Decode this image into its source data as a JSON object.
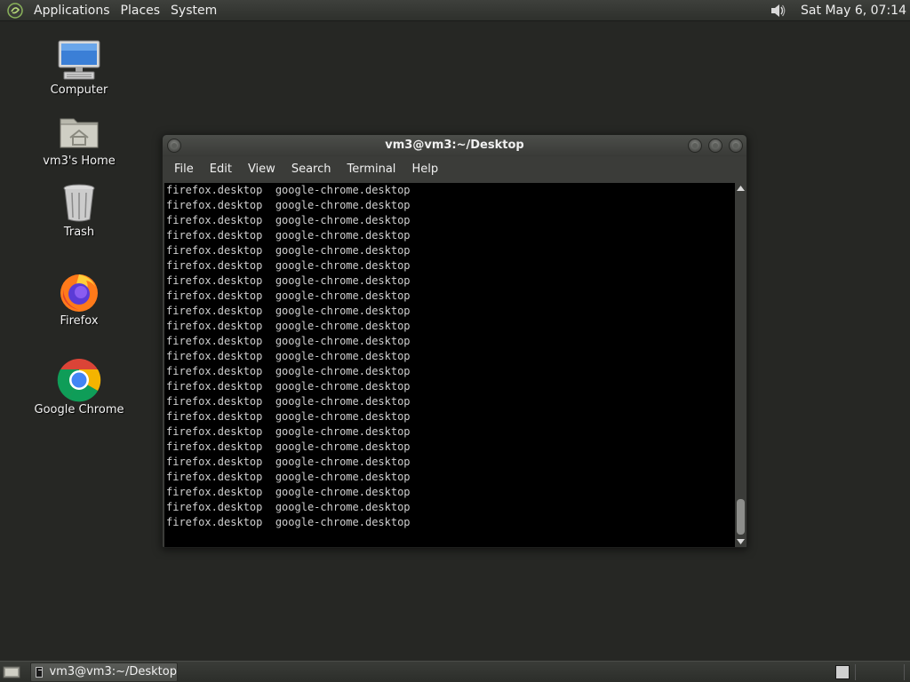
{
  "top_panel": {
    "menus": [
      {
        "label": "Applications"
      },
      {
        "label": "Places"
      },
      {
        "label": "System"
      }
    ],
    "clock": "Sat May  6, 07:14",
    "icons": {
      "logo": "distro-logo-icon",
      "volume": "speaker-icon"
    }
  },
  "desktop": {
    "icons": [
      {
        "label": "Computer",
        "icon": "computer-icon"
      },
      {
        "label": "vm3's Home",
        "icon": "home-folder-icon"
      },
      {
        "label": "Trash",
        "icon": "trash-icon"
      },
      {
        "label": "Firefox",
        "icon": "firefox-icon"
      },
      {
        "label": "Google Chrome",
        "icon": "chrome-icon"
      }
    ]
  },
  "terminal": {
    "title": "vm3@vm3:~/Desktop",
    "menu": [
      {
        "label": "File"
      },
      {
        "label": "Edit"
      },
      {
        "label": "View"
      },
      {
        "label": "Search"
      },
      {
        "label": "Terminal"
      },
      {
        "label": "Help"
      }
    ],
    "lines": [
      "firefox.desktop  google-chrome.desktop",
      "firefox.desktop  google-chrome.desktop",
      "firefox.desktop  google-chrome.desktop",
      "firefox.desktop  google-chrome.desktop",
      "firefox.desktop  google-chrome.desktop",
      "firefox.desktop  google-chrome.desktop",
      "firefox.desktop  google-chrome.desktop",
      "firefox.desktop  google-chrome.desktop",
      "firefox.desktop  google-chrome.desktop",
      "firefox.desktop  google-chrome.desktop",
      "firefox.desktop  google-chrome.desktop",
      "firefox.desktop  google-chrome.desktop",
      "firefox.desktop  google-chrome.desktop",
      "firefox.desktop  google-chrome.desktop",
      "firefox.desktop  google-chrome.desktop",
      "firefox.desktop  google-chrome.desktop",
      "firefox.desktop  google-chrome.desktop",
      "firefox.desktop  google-chrome.desktop",
      "firefox.desktop  google-chrome.desktop",
      "firefox.desktop  google-chrome.desktop",
      "firefox.desktop  google-chrome.desktop",
      "firefox.desktop  google-chrome.desktop",
      "firefox.desktop  google-chrome.desktop"
    ],
    "colors": {
      "background": "#000000",
      "foreground": "#cfcfcf"
    }
  },
  "bottom_panel": {
    "tasks": [
      {
        "label": "vm3@vm3:~/Desktop",
        "icon": "terminal-icon"
      }
    ],
    "icons": {
      "show_desktop": "show-desktop-icon",
      "workspace": "workspace-switcher-icon"
    }
  }
}
